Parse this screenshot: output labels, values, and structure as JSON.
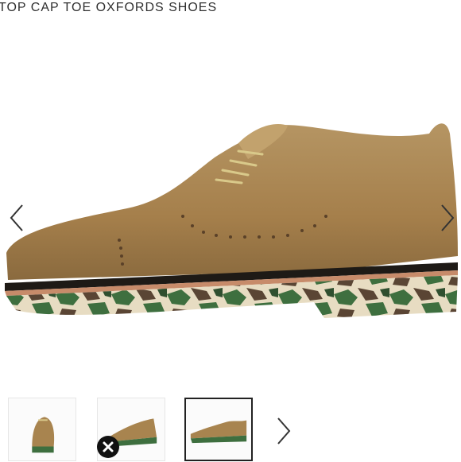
{
  "product": {
    "title": "TOP CAP TOE OXFORDS SHOES"
  },
  "gallery": {
    "prev_icon": "chevron-left-icon",
    "next_icon": "chevron-right-icon",
    "thumbnails": [
      {
        "view": "front-angle"
      },
      {
        "view": "three-quarter"
      },
      {
        "view": "side",
        "active": true
      }
    ],
    "thumb_next_icon": "chevron-right-icon",
    "close_icon": "close-icon"
  },
  "colors": {
    "leather": "#a8844f",
    "camo_light": "#e8dcc0",
    "camo_green": "#3c6e3d",
    "camo_brown": "#5b4636"
  }
}
